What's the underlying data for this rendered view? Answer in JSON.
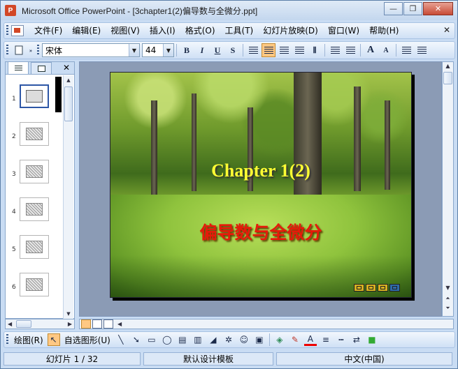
{
  "window": {
    "app_icon_letter": "P",
    "title": "Microsoft Office PowerPoint - [3chapter1(2)偏导数与全微分.ppt]",
    "minimize_glyph": "—",
    "maximize_glyph": "❐",
    "close_glyph": "✕"
  },
  "menubar": {
    "items": [
      {
        "label": "文件(F)"
      },
      {
        "label": "编辑(E)"
      },
      {
        "label": "视图(V)"
      },
      {
        "label": "插入(I)"
      },
      {
        "label": "格式(O)"
      },
      {
        "label": "工具(T)"
      },
      {
        "label": "幻灯片放映(D)"
      },
      {
        "label": "窗口(W)"
      },
      {
        "label": "帮助(H)"
      }
    ],
    "close_glyph": "✕"
  },
  "format_toolbar": {
    "font_name": "宋体",
    "font_size": "44",
    "bold": "B",
    "italic": "I",
    "underline": "U",
    "shadow": "S",
    "increase_font": "A",
    "decrease_font": "A"
  },
  "left_pane": {
    "close_glyph": "✕",
    "slides": [
      {
        "number": "1"
      },
      {
        "number": "2"
      },
      {
        "number": "3"
      },
      {
        "number": "4"
      },
      {
        "number": "5"
      },
      {
        "number": "6"
      }
    ]
  },
  "slide": {
    "title": "Chapter  1(2)",
    "subtitle": "偏导数与全微分"
  },
  "draw_toolbar": {
    "draw_label": "绘图(R)",
    "autoshape_label": "自选图形(U)"
  },
  "statusbar": {
    "slide_position": "幻灯片 1 / 32",
    "design_template": "默认设计模板",
    "language": "中文(中国)"
  },
  "colors": {
    "title_yellow": "#ffff33",
    "subtitle_red": "#e61a0a",
    "chrome_blue": "#c9dcf3",
    "active_orange": "#ffc883"
  }
}
